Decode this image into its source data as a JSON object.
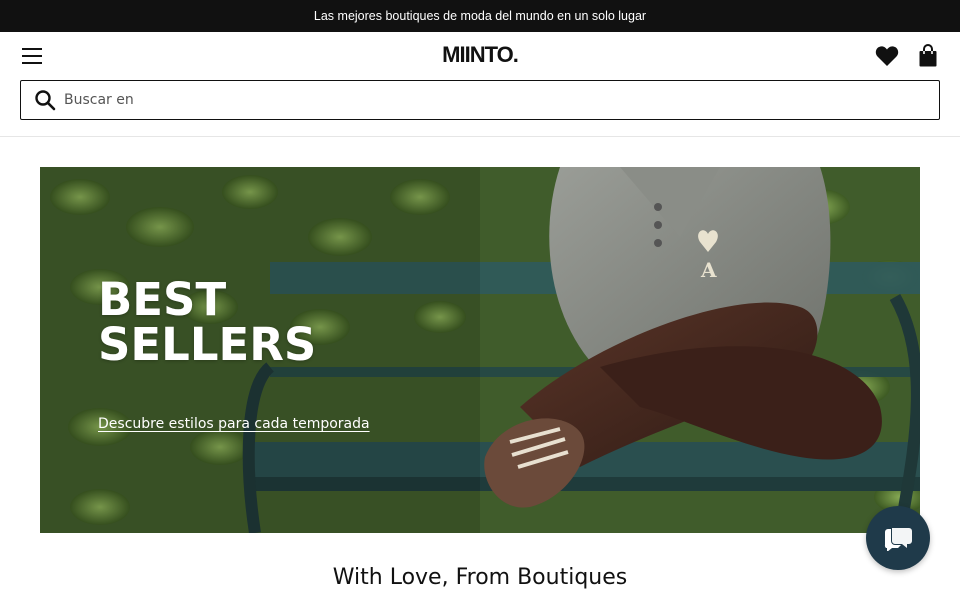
{
  "promo_bar": {
    "text": "Las mejores boutiques de moda del mundo en un solo lugar"
  },
  "header": {
    "logo": "MIINTO.",
    "icons": [
      "menu-icon",
      "heart-icon",
      "bag-icon"
    ]
  },
  "search": {
    "placeholder": "Buscar en",
    "value": "",
    "icon": "search-icon"
  },
  "hero": {
    "title_line1": "BEST",
    "title_line2": "SELLERS",
    "link": "Descubre estilos para cada temporada"
  },
  "section": {
    "title": "With Love, From Boutiques"
  },
  "chat": {
    "icon": "chat-icon"
  },
  "colors": {
    "promo_bg": "#111111",
    "text": "#111111",
    "chat_bg": "#1f3a4a"
  }
}
